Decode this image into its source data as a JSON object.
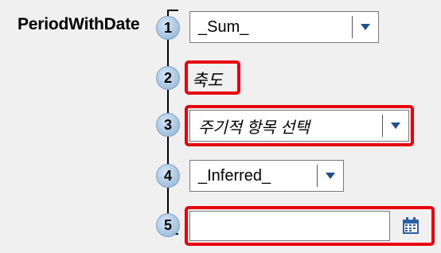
{
  "function_label": "PeriodWithDate",
  "steps": [
    "1",
    "2",
    "3",
    "4",
    "5"
  ],
  "aggregation": {
    "value": "_Sum_"
  },
  "axis": {
    "label": "축도"
  },
  "periodic_member": {
    "placeholder": "주기적 항목 선택"
  },
  "inferred": {
    "value": "_Inferred_"
  },
  "date": {
    "value": ""
  },
  "icons": {
    "dropdown": "chevron-down-icon",
    "date_picker": "calendar-icon"
  },
  "colors": {
    "highlight": "#e8000e",
    "arrow": "#1f4f8f",
    "calendar": "#2b5ea3",
    "badge": "#aac6e2"
  }
}
